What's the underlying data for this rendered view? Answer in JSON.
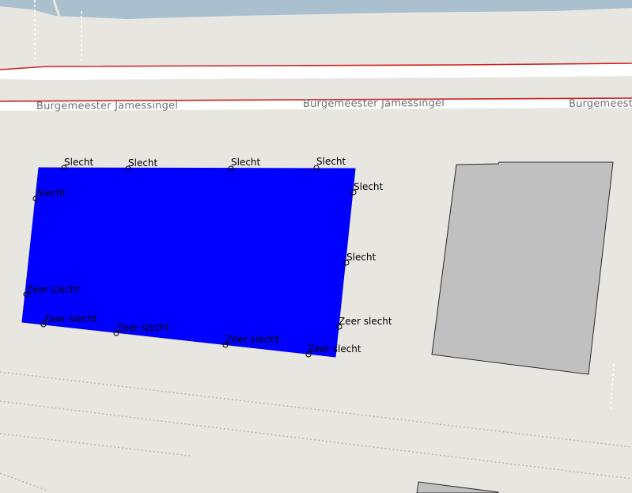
{
  "map": {
    "colors": {
      "land": "#e8e6e1",
      "water": "#aac0cf",
      "road_fill": "#ffffff",
      "road_casing": "#d11f1f",
      "building": "#c0c0c0",
      "selected_polygon": "#0000ff",
      "rail": "#b9b6b1"
    },
    "street": {
      "name": "Burgemeester Jamessingel",
      "labels": [
        "Burgemeester Jamessingel",
        "Burgemeester Jamessingel",
        "Burgemeester Jamessingel"
      ]
    },
    "condition_labels": [
      "Slecht",
      "Slecht",
      "Slecht",
      "Slecht",
      "Slecht",
      "Slecht",
      "Slecht",
      "Zeer slecht",
      "Zeer slecht",
      "Zeer slecht",
      "Zeer slecht",
      "Zeer slecht",
      "Zeer slecht"
    ],
    "condition_labels_detail": {
      "top_edge": [
        "Slecht",
        "Slecht",
        "Slecht",
        "Slecht"
      ],
      "left_edge": [
        "Slecht",
        "Zeer slecht"
      ],
      "right_edge": [
        "Slecht",
        "Slecht",
        "Zeer slecht"
      ],
      "bottom_edge": [
        "Zeer slecht",
        "Zeer slecht",
        "Zeer slecht",
        "Zeer slecht"
      ]
    }
  }
}
